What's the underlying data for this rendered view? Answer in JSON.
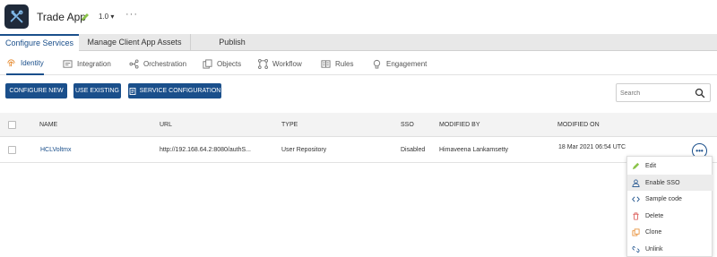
{
  "header": {
    "app_name": "Trade App",
    "version": "1.0 ▾",
    "more": "···"
  },
  "tabs": [
    {
      "label": "Configure Services",
      "active": true
    },
    {
      "label": "Manage Client App Assets",
      "active": false
    },
    {
      "label": "Publish",
      "active": false
    }
  ],
  "subnav": [
    {
      "label": "Identity",
      "icon": "fingerprint-icon",
      "active": true
    },
    {
      "label": "Integration",
      "icon": "integration-icon"
    },
    {
      "label": "Orchestration",
      "icon": "orchestration-icon"
    },
    {
      "label": "Objects",
      "icon": "objects-icon"
    },
    {
      "label": "Workflow",
      "icon": "workflow-icon"
    },
    {
      "label": "Rules",
      "icon": "rules-icon"
    },
    {
      "label": "Engagement",
      "icon": "engagement-icon"
    }
  ],
  "toolbar": {
    "configure_new": "CONFIGURE NEW",
    "use_existing": "USE EXISTING",
    "service_configuration": "SERVICE CONFIGURATION"
  },
  "search": {
    "placeholder": "Search"
  },
  "table": {
    "columns": [
      "NAME",
      "URL",
      "TYPE",
      "SSO",
      "MODIFIED BY",
      "MODIFIED ON"
    ],
    "rows": [
      {
        "name": "HCLVoltmx",
        "url": "http://192.168.64.2:8080/authS...",
        "type": "User Repository",
        "sso": "Disabled",
        "modified_by": "Himaveena Lankamsetty",
        "modified_on": "18 Mar 2021 06:54 UTC"
      }
    ]
  },
  "context_menu": [
    {
      "label": "Edit",
      "icon": "pencil-icon"
    },
    {
      "label": "Enable SSO",
      "icon": "user-icon",
      "highlighted": true
    },
    {
      "label": "Sample code",
      "icon": "code-icon"
    },
    {
      "label": "Delete",
      "icon": "trash-icon"
    },
    {
      "label": "Clone",
      "icon": "clone-icon"
    },
    {
      "label": "Unlink",
      "icon": "unlink-icon"
    }
  ],
  "colors": {
    "primary": "#1a4f8b",
    "logo_bg": "#1f2a3a",
    "accent_green": "#7cb342",
    "delete_red": "#d9534f"
  }
}
